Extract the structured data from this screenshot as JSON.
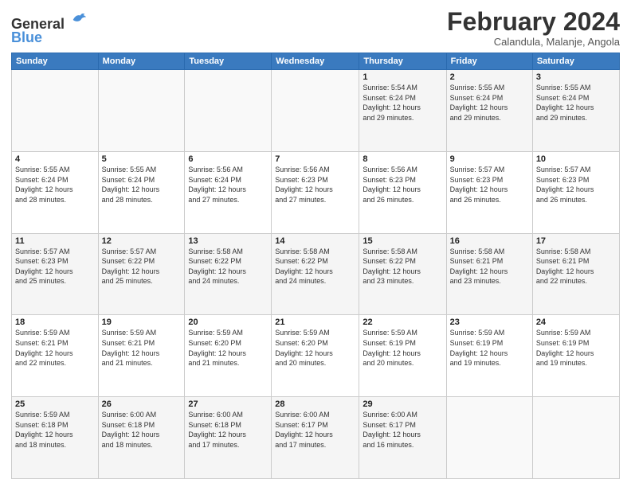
{
  "logo": {
    "line1": "General",
    "line2": "Blue"
  },
  "header": {
    "month": "February 2024",
    "location": "Calandula, Malanje, Angola"
  },
  "days_of_week": [
    "Sunday",
    "Monday",
    "Tuesday",
    "Wednesday",
    "Thursday",
    "Friday",
    "Saturday"
  ],
  "weeks": [
    [
      {
        "day": "",
        "info": ""
      },
      {
        "day": "",
        "info": ""
      },
      {
        "day": "",
        "info": ""
      },
      {
        "day": "",
        "info": ""
      },
      {
        "day": "1",
        "info": "Sunrise: 5:54 AM\nSunset: 6:24 PM\nDaylight: 12 hours\nand 29 minutes."
      },
      {
        "day": "2",
        "info": "Sunrise: 5:55 AM\nSunset: 6:24 PM\nDaylight: 12 hours\nand 29 minutes."
      },
      {
        "day": "3",
        "info": "Sunrise: 5:55 AM\nSunset: 6:24 PM\nDaylight: 12 hours\nand 29 minutes."
      }
    ],
    [
      {
        "day": "4",
        "info": "Sunrise: 5:55 AM\nSunset: 6:24 PM\nDaylight: 12 hours\nand 28 minutes."
      },
      {
        "day": "5",
        "info": "Sunrise: 5:55 AM\nSunset: 6:24 PM\nDaylight: 12 hours\nand 28 minutes."
      },
      {
        "day": "6",
        "info": "Sunrise: 5:56 AM\nSunset: 6:24 PM\nDaylight: 12 hours\nand 27 minutes."
      },
      {
        "day": "7",
        "info": "Sunrise: 5:56 AM\nSunset: 6:23 PM\nDaylight: 12 hours\nand 27 minutes."
      },
      {
        "day": "8",
        "info": "Sunrise: 5:56 AM\nSunset: 6:23 PM\nDaylight: 12 hours\nand 26 minutes."
      },
      {
        "day": "9",
        "info": "Sunrise: 5:57 AM\nSunset: 6:23 PM\nDaylight: 12 hours\nand 26 minutes."
      },
      {
        "day": "10",
        "info": "Sunrise: 5:57 AM\nSunset: 6:23 PM\nDaylight: 12 hours\nand 26 minutes."
      }
    ],
    [
      {
        "day": "11",
        "info": "Sunrise: 5:57 AM\nSunset: 6:23 PM\nDaylight: 12 hours\nand 25 minutes."
      },
      {
        "day": "12",
        "info": "Sunrise: 5:57 AM\nSunset: 6:22 PM\nDaylight: 12 hours\nand 25 minutes."
      },
      {
        "day": "13",
        "info": "Sunrise: 5:58 AM\nSunset: 6:22 PM\nDaylight: 12 hours\nand 24 minutes."
      },
      {
        "day": "14",
        "info": "Sunrise: 5:58 AM\nSunset: 6:22 PM\nDaylight: 12 hours\nand 24 minutes."
      },
      {
        "day": "15",
        "info": "Sunrise: 5:58 AM\nSunset: 6:22 PM\nDaylight: 12 hours\nand 23 minutes."
      },
      {
        "day": "16",
        "info": "Sunrise: 5:58 AM\nSunset: 6:21 PM\nDaylight: 12 hours\nand 23 minutes."
      },
      {
        "day": "17",
        "info": "Sunrise: 5:58 AM\nSunset: 6:21 PM\nDaylight: 12 hours\nand 22 minutes."
      }
    ],
    [
      {
        "day": "18",
        "info": "Sunrise: 5:59 AM\nSunset: 6:21 PM\nDaylight: 12 hours\nand 22 minutes."
      },
      {
        "day": "19",
        "info": "Sunrise: 5:59 AM\nSunset: 6:21 PM\nDaylight: 12 hours\nand 21 minutes."
      },
      {
        "day": "20",
        "info": "Sunrise: 5:59 AM\nSunset: 6:20 PM\nDaylight: 12 hours\nand 21 minutes."
      },
      {
        "day": "21",
        "info": "Sunrise: 5:59 AM\nSunset: 6:20 PM\nDaylight: 12 hours\nand 20 minutes."
      },
      {
        "day": "22",
        "info": "Sunrise: 5:59 AM\nSunset: 6:19 PM\nDaylight: 12 hours\nand 20 minutes."
      },
      {
        "day": "23",
        "info": "Sunrise: 5:59 AM\nSunset: 6:19 PM\nDaylight: 12 hours\nand 19 minutes."
      },
      {
        "day": "24",
        "info": "Sunrise: 5:59 AM\nSunset: 6:19 PM\nDaylight: 12 hours\nand 19 minutes."
      }
    ],
    [
      {
        "day": "25",
        "info": "Sunrise: 5:59 AM\nSunset: 6:18 PM\nDaylight: 12 hours\nand 18 minutes."
      },
      {
        "day": "26",
        "info": "Sunrise: 6:00 AM\nSunset: 6:18 PM\nDaylight: 12 hours\nand 18 minutes."
      },
      {
        "day": "27",
        "info": "Sunrise: 6:00 AM\nSunset: 6:18 PM\nDaylight: 12 hours\nand 17 minutes."
      },
      {
        "day": "28",
        "info": "Sunrise: 6:00 AM\nSunset: 6:17 PM\nDaylight: 12 hours\nand 17 minutes."
      },
      {
        "day": "29",
        "info": "Sunrise: 6:00 AM\nSunset: 6:17 PM\nDaylight: 12 hours\nand 16 minutes."
      },
      {
        "day": "",
        "info": ""
      },
      {
        "day": "",
        "info": ""
      }
    ]
  ]
}
